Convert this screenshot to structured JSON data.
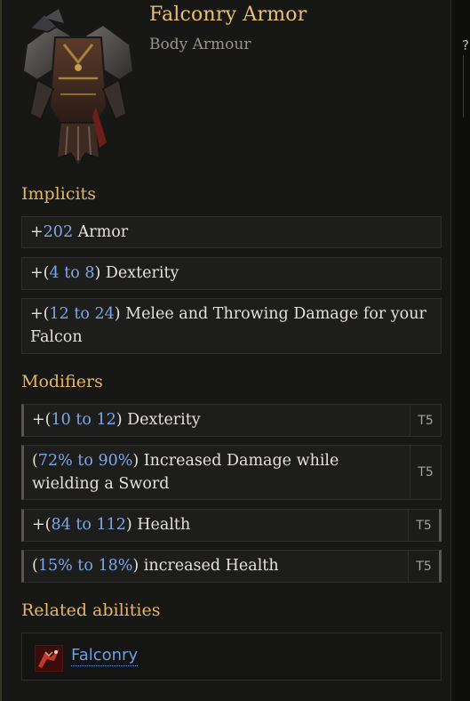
{
  "item": {
    "name": "Falconry Armor",
    "type": "Body Armour",
    "image_icon": "body-armour-image"
  },
  "edge": {
    "help_char": "?"
  },
  "implicits": {
    "title": "Implicits",
    "rows": [
      {
        "pre": "+",
        "n1": "202",
        "mid": "",
        "n2": "",
        "post": " Armor",
        "close": ""
      },
      {
        "pre": "+(",
        "n1": "4",
        "mid": " to ",
        "n2": "8",
        "close": ")",
        "post": " Dexterity"
      },
      {
        "pre": "+(",
        "n1": "12",
        "mid": " to ",
        "n2": "24",
        "close": ")",
        "post": " Melee and Throwing Damage for your Falcon"
      }
    ]
  },
  "modifiers": {
    "title": "Modifiers",
    "rows": [
      {
        "pre": "+(",
        "n1": "10",
        "mid": " to ",
        "n2": "12",
        "close": ")",
        "post": " Dexterity",
        "tier": "T5"
      },
      {
        "pre": "(",
        "n1": "72%",
        "mid": " to ",
        "n2": "90%",
        "close": ")",
        "post": " Increased Damage while wielding a Sword",
        "tier": "T5"
      },
      {
        "pre": "+(",
        "n1": "84",
        "mid": " to ",
        "n2": "112",
        "close": ")",
        "post": " Health",
        "tier": "T5"
      },
      {
        "pre": "(",
        "n1": "15%",
        "mid": " to ",
        "n2": "18%",
        "close": ")",
        "post": " increased Health",
        "tier": "T5"
      }
    ]
  },
  "related": {
    "title": "Related abilities",
    "abilities": [
      {
        "label": "Falconry",
        "icon": "falconry-icon"
      }
    ]
  },
  "colors": {
    "name": "#e8c170",
    "section": "#e7b56a",
    "number": "#7ea6e8",
    "link": "#6f9ee6"
  }
}
